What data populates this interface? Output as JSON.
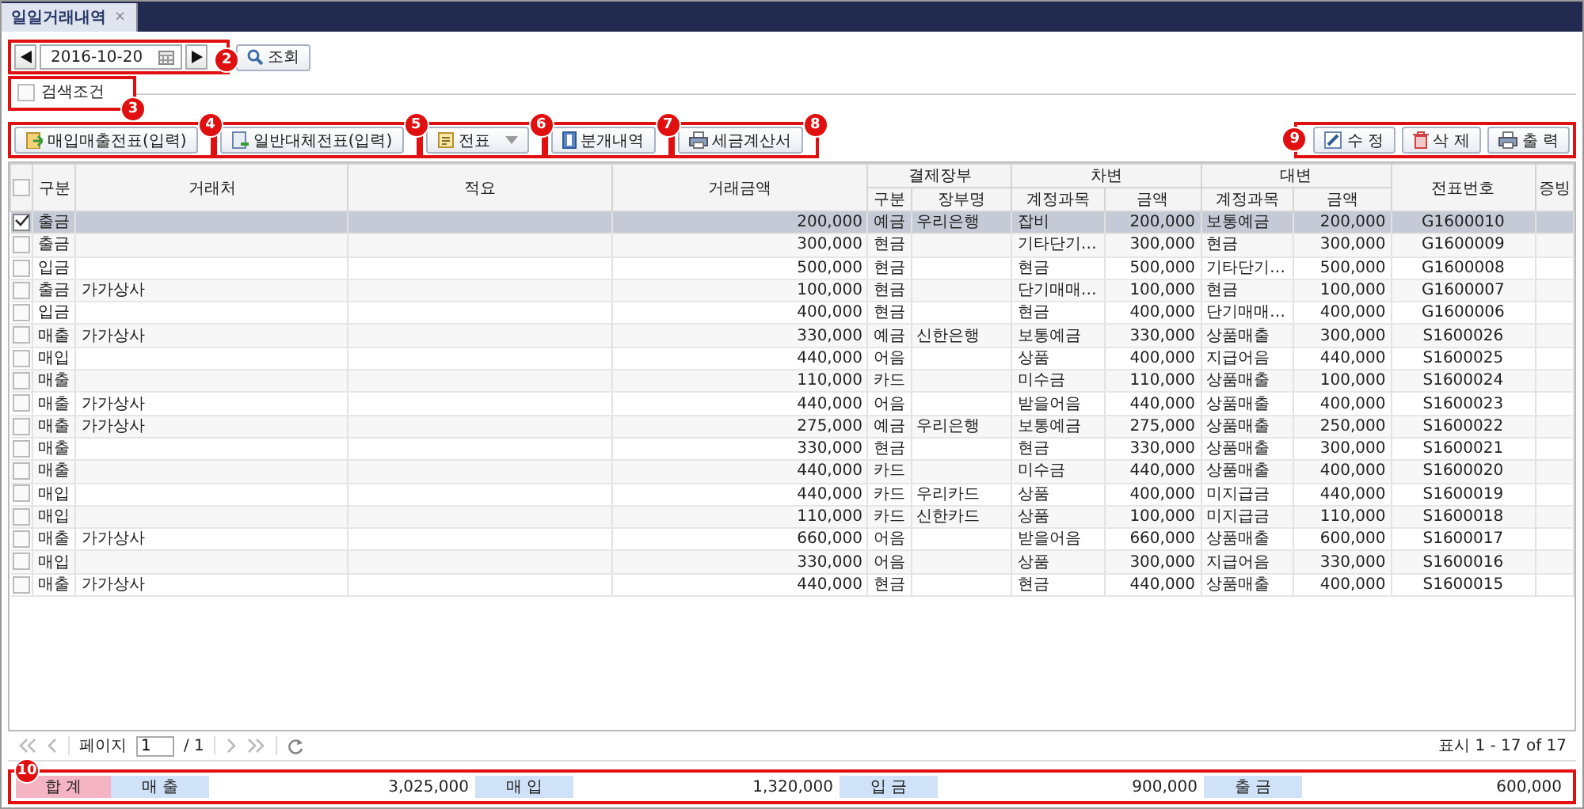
{
  "tab": {
    "title": "일일거래내역",
    "close": "×"
  },
  "date_bar": {
    "date": "2016-10-20",
    "search_button": "조회",
    "callout": "2"
  },
  "search_conditions": {
    "label": "검색조건",
    "checked": false,
    "callout": "3"
  },
  "toolbar_left": [
    {
      "label": "매입매출전표(입력)",
      "kind": "entry",
      "callout": "4"
    },
    {
      "label": "일반대체전표(입력)",
      "kind": "transfer",
      "callout": "5"
    },
    {
      "label": "전표",
      "kind": "dropdown",
      "callout": "6"
    },
    {
      "label": "분개내역",
      "kind": "journal",
      "callout": "7"
    },
    {
      "label": "세금계산서",
      "kind": "print",
      "callout": "8"
    }
  ],
  "toolbar_right": {
    "callout": "9",
    "buttons": [
      {
        "label": "수 정",
        "kind": "edit"
      },
      {
        "label": "삭 제",
        "kind": "delete"
      },
      {
        "label": "출 력",
        "kind": "print"
      }
    ]
  },
  "table": {
    "columns": [
      {
        "kind": "check",
        "checked": false
      },
      {
        "label": "구분",
        "kind": "text"
      },
      {
        "label": "거래처",
        "kind": "text"
      },
      {
        "label": "적요",
        "kind": "text"
      },
      {
        "label": "거래금액",
        "kind": "amount"
      },
      {
        "label": "결제장부",
        "colspan": 2,
        "children": [
          {
            "label": "구분",
            "kind": "text"
          },
          {
            "label": "장부명",
            "kind": "text"
          }
        ]
      },
      {
        "label": "차변",
        "colspan": 2,
        "children": [
          {
            "label": "계정과목",
            "kind": "text"
          },
          {
            "label": "금액",
            "kind": "amount"
          }
        ]
      },
      {
        "label": "대변",
        "colspan": 2,
        "children": [
          {
            "label": "계정과목",
            "kind": "text"
          },
          {
            "label": "금액",
            "kind": "amount"
          }
        ]
      },
      {
        "label": "전표번호",
        "kind": "code"
      },
      {
        "label": "증빙",
        "kind": "text"
      }
    ],
    "rows": [
      {
        "selected": true,
        "cells": [
          "",
          "출금",
          "",
          "",
          "200,000",
          "예금",
          "우리은행",
          "잡비",
          "200,000",
          "보통예금",
          "200,000",
          "G1600010",
          ""
        ]
      },
      {
        "selected": false,
        "cells": [
          "",
          "출금",
          "",
          "",
          "300,000",
          "현금",
          "",
          "기타단기…",
          "300,000",
          "현금",
          "300,000",
          "G1600009",
          ""
        ]
      },
      {
        "selected": false,
        "cells": [
          "",
          "입금",
          "",
          "",
          "500,000",
          "현금",
          "",
          "현금",
          "500,000",
          "기타단기…",
          "500,000",
          "G1600008",
          ""
        ]
      },
      {
        "selected": false,
        "cells": [
          "",
          "출금",
          "가가상사",
          "",
          "100,000",
          "현금",
          "",
          "단기매매…",
          "100,000",
          "현금",
          "100,000",
          "G1600007",
          ""
        ]
      },
      {
        "selected": false,
        "cells": [
          "",
          "입금",
          "",
          "",
          "400,000",
          "현금",
          "",
          "현금",
          "400,000",
          "단기매매…",
          "400,000",
          "G1600006",
          ""
        ]
      },
      {
        "selected": false,
        "cells": [
          "",
          "매출",
          "가가상사",
          "",
          "330,000",
          "예금",
          "신한은행",
          "보통예금",
          "330,000",
          "상품매출",
          "300,000",
          "S1600026",
          ""
        ]
      },
      {
        "selected": false,
        "cells": [
          "",
          "매입",
          "",
          "",
          "440,000",
          "어음",
          "",
          "상품",
          "400,000",
          "지급어음",
          "440,000",
          "S1600025",
          ""
        ]
      },
      {
        "selected": false,
        "cells": [
          "",
          "매출",
          "",
          "",
          "110,000",
          "카드",
          "",
          "미수금",
          "110,000",
          "상품매출",
          "100,000",
          "S1600024",
          ""
        ]
      },
      {
        "selected": false,
        "cells": [
          "",
          "매출",
          "가가상사",
          "",
          "440,000",
          "어음",
          "",
          "받을어음",
          "440,000",
          "상품매출",
          "400,000",
          "S1600023",
          ""
        ]
      },
      {
        "selected": false,
        "cells": [
          "",
          "매출",
          "가가상사",
          "",
          "275,000",
          "예금",
          "우리은행",
          "보통예금",
          "275,000",
          "상품매출",
          "250,000",
          "S1600022",
          ""
        ]
      },
      {
        "selected": false,
        "cells": [
          "",
          "매출",
          "",
          "",
          "330,000",
          "현금",
          "",
          "현금",
          "330,000",
          "상품매출",
          "300,000",
          "S1600021",
          ""
        ]
      },
      {
        "selected": false,
        "cells": [
          "",
          "매출",
          "",
          "",
          "440,000",
          "카드",
          "",
          "미수금",
          "440,000",
          "상품매출",
          "400,000",
          "S1600020",
          ""
        ]
      },
      {
        "selected": false,
        "cells": [
          "",
          "매입",
          "",
          "",
          "440,000",
          "카드",
          "우리카드",
          "상품",
          "400,000",
          "미지급금",
          "440,000",
          "S1600019",
          ""
        ]
      },
      {
        "selected": false,
        "cells": [
          "",
          "매입",
          "",
          "",
          "110,000",
          "카드",
          "신한카드",
          "상품",
          "100,000",
          "미지급금",
          "110,000",
          "S1600018",
          ""
        ]
      },
      {
        "selected": false,
        "cells": [
          "",
          "매출",
          "가가상사",
          "",
          "660,000",
          "어음",
          "",
          "받을어음",
          "660,000",
          "상품매출",
          "600,000",
          "S1600017",
          ""
        ]
      },
      {
        "selected": false,
        "cells": [
          "",
          "매입",
          "",
          "",
          "330,000",
          "어음",
          "",
          "상품",
          "300,000",
          "지급어음",
          "330,000",
          "S1600016",
          ""
        ]
      },
      {
        "selected": false,
        "cells": [
          "",
          "매출",
          "가가상사",
          "",
          "440,000",
          "현금",
          "",
          "현금",
          "440,000",
          "상품매출",
          "400,000",
          "S1600015",
          ""
        ]
      }
    ]
  },
  "pager": {
    "page_label": "페이지",
    "page": "1",
    "total": "/ 1",
    "status": "표시 1 - 17 of 17"
  },
  "summary": {
    "callout": "10",
    "title": "합 계",
    "items": [
      {
        "label": "매 출",
        "value": "3,025,000"
      },
      {
        "label": "매 입",
        "value": "1,320,000"
      },
      {
        "label": "입 금",
        "value": "900,000"
      },
      {
        "label": "출 금",
        "value": "600,000"
      }
    ]
  }
}
